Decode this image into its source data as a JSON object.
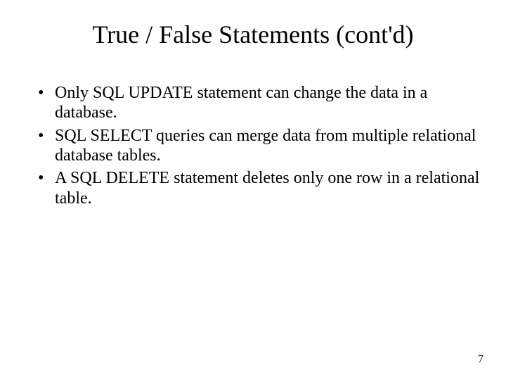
{
  "title": "True / False Statements (cont'd)",
  "bullets": [
    "Only SQL UPDATE statement can change the data in a database.",
    "SQL SELECT queries can merge data from multiple relational database tables.",
    "A SQL DELETE statement deletes only one row in a relational table."
  ],
  "page_number": "7"
}
